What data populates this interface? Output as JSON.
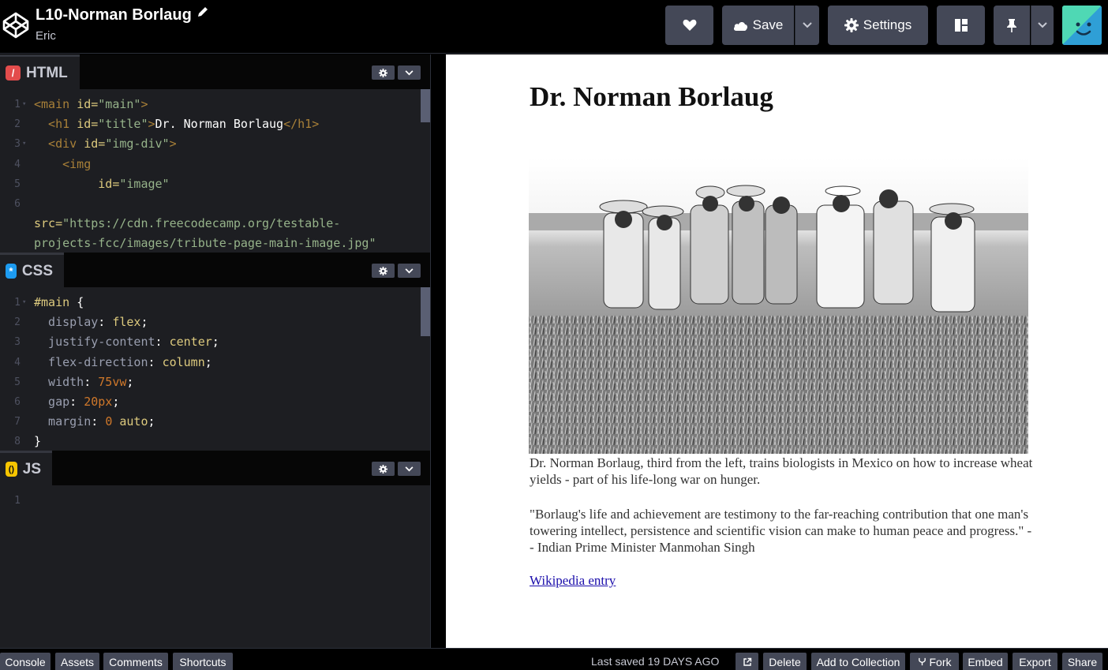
{
  "header": {
    "pen_title": "L10-Norman Borlaug",
    "author": "Eric",
    "save_label": "Save",
    "settings_label": "Settings"
  },
  "editors": {
    "html": {
      "label": "HTML",
      "icon_glyph": "/",
      "line_numbers": [
        "1",
        "2",
        "3",
        "4",
        "5",
        "6"
      ],
      "lines": [
        [
          {
            "c": "tag",
            "t": "<main "
          },
          {
            "c": "attr",
            "t": "id="
          },
          {
            "c": "str",
            "t": "\"main\""
          },
          {
            "c": "tag",
            "t": ">"
          }
        ],
        [
          {
            "c": "tag",
            "t": "  <h1 "
          },
          {
            "c": "attr",
            "t": "id="
          },
          {
            "c": "str",
            "t": "\"title\""
          },
          {
            "c": "tag",
            "t": ">"
          },
          {
            "c": "txt",
            "t": "Dr. Norman Borlaug"
          },
          {
            "c": "tag",
            "t": "</h1>"
          }
        ],
        [
          {
            "c": "tag",
            "t": "  <div "
          },
          {
            "c": "attr",
            "t": "id="
          },
          {
            "c": "str",
            "t": "\"img-div\""
          },
          {
            "c": "tag",
            "t": ">"
          }
        ],
        [
          {
            "c": "tag",
            "t": "    <img"
          }
        ],
        [
          {
            "c": "attr",
            "t": "         id="
          },
          {
            "c": "str",
            "t": "\"image\""
          }
        ],
        [
          {
            "c": "txt",
            "t": ""
          }
        ],
        [
          {
            "c": "attr",
            "t": "src="
          },
          {
            "c": "str",
            "t": "\"https://cdn.freecodecamp.org/testable-"
          }
        ],
        [
          {
            "c": "str",
            "t": "projects-fcc/images/tribute-page-main-image.jpg\""
          }
        ]
      ]
    },
    "css": {
      "label": "CSS",
      "icon_glyph": "*",
      "line_numbers": [
        "1",
        "2",
        "3",
        "4",
        "5",
        "6",
        "7",
        "8"
      ],
      "lines": [
        [
          {
            "c": "sel",
            "t": "#main "
          },
          {
            "c": "punc",
            "t": "{"
          }
        ],
        [
          {
            "c": "prop",
            "t": "  display"
          },
          {
            "c": "punc",
            "t": ": "
          },
          {
            "c": "val",
            "t": "flex"
          },
          {
            "c": "punc",
            "t": ";"
          }
        ],
        [
          {
            "c": "prop",
            "t": "  justify-content"
          },
          {
            "c": "punc",
            "t": ": "
          },
          {
            "c": "val",
            "t": "center"
          },
          {
            "c": "punc",
            "t": ";"
          }
        ],
        [
          {
            "c": "prop",
            "t": "  flex-direction"
          },
          {
            "c": "punc",
            "t": ": "
          },
          {
            "c": "val",
            "t": "column"
          },
          {
            "c": "punc",
            "t": ";"
          }
        ],
        [
          {
            "c": "prop",
            "t": "  width"
          },
          {
            "c": "punc",
            "t": ": "
          },
          {
            "c": "num",
            "t": "75vw"
          },
          {
            "c": "punc",
            "t": ";"
          }
        ],
        [
          {
            "c": "prop",
            "t": "  gap"
          },
          {
            "c": "punc",
            "t": ": "
          },
          {
            "c": "num",
            "t": "20px"
          },
          {
            "c": "punc",
            "t": ";"
          }
        ],
        [
          {
            "c": "prop",
            "t": "  margin"
          },
          {
            "c": "punc",
            "t": ": "
          },
          {
            "c": "num",
            "t": "0"
          },
          {
            "c": "val",
            "t": " auto"
          },
          {
            "c": "punc",
            "t": ";"
          }
        ],
        [
          {
            "c": "punc",
            "t": "}"
          }
        ]
      ]
    },
    "js": {
      "label": "JS",
      "icon_glyph": "()",
      "line_numbers": [
        "1"
      ]
    }
  },
  "preview": {
    "title": "Dr. Norman Borlaug",
    "caption": "Dr. Norman Borlaug, third from the left, trains biologists in Mexico on how to increase wheat yields - part of his life-long war on hunger.",
    "quote": "\"Borlaug's life and achievement are testimony to the far-reaching contribution that one man's towering intellect, persistence and scientific vision can make to human peace and progress.\" -- Indian Prime Minister Manmohan Singh",
    "link": "Wikipedia entry"
  },
  "footer": {
    "console": "Console",
    "assets": "Assets",
    "comments": "Comments",
    "shortcuts": "Shortcuts",
    "last_saved_prefix": "Last saved",
    "last_saved_value": "19 DAYS AGO",
    "delete": "Delete",
    "add_to_collection": "Add to Collection",
    "fork": "Fork",
    "embed": "Embed",
    "export": "Export",
    "share": "Share"
  },
  "colors": {
    "html_icon": "#e34c4c",
    "css_icon": "#1d9bf0",
    "js_icon": "#f7c500",
    "button_bg": "#444857"
  }
}
